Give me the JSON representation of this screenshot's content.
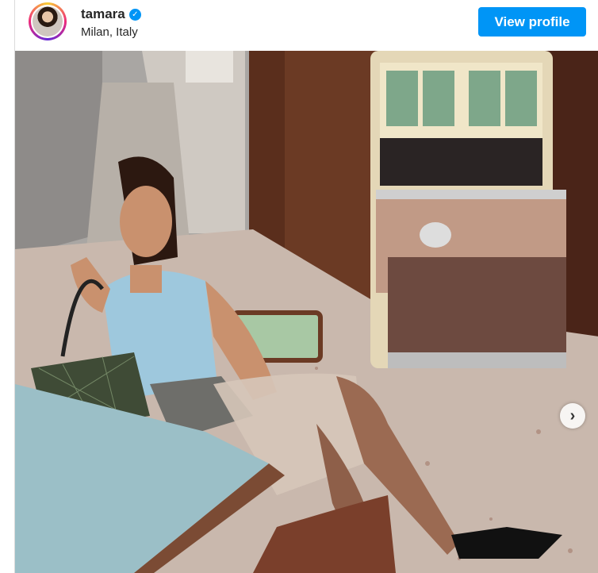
{
  "header": {
    "username": "tamara",
    "location": "Milan, Italy",
    "view_profile_label": "View profile",
    "verified_glyph": "✓"
  },
  "post": {
    "next_glyph": "›"
  },
  "colors": {
    "primary_button": "#0095f6",
    "text": "#262626",
    "border": "#dbdbdb"
  },
  "icons": [
    "avatar",
    "verified-badge-icon",
    "chevron-right-icon"
  ]
}
